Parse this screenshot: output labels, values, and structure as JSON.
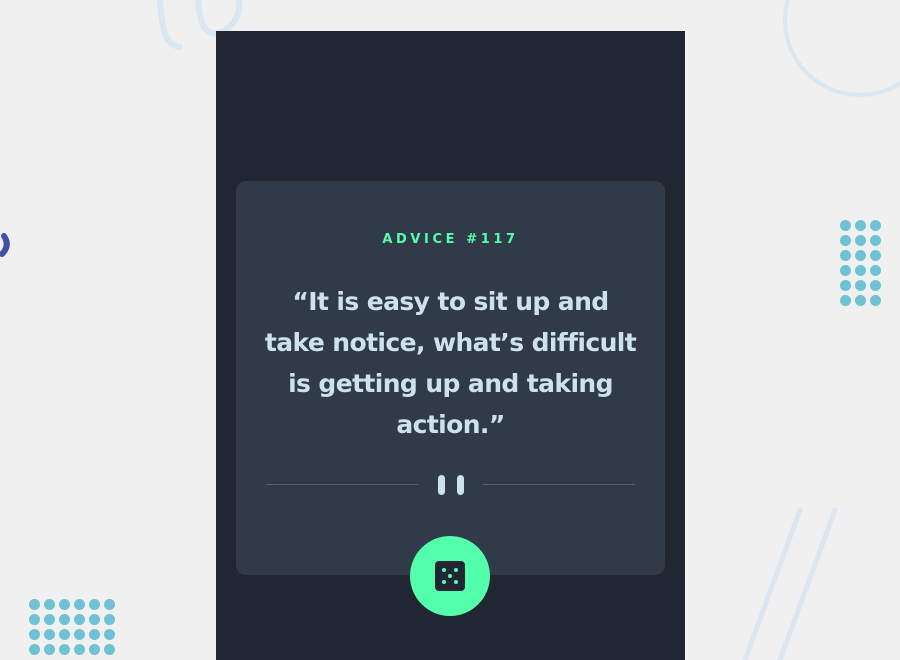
{
  "advice": {
    "heading": "ADVICE #117",
    "quote": "“It is easy to sit up and take notice, what’s difficult is getting up and taking action.”"
  },
  "icons": {
    "divider": "pause-icon",
    "button": "dice-icon"
  },
  "colors": {
    "page_background": "#f0f0f0",
    "panel": "#202632",
    "card": "#313a49",
    "accent": "#53ffaa",
    "quote_text": "#cee3e9",
    "divider_line": "#4f5d74",
    "decor_dots": "#6fc2d4",
    "decor_lines": "#dce6f0"
  }
}
